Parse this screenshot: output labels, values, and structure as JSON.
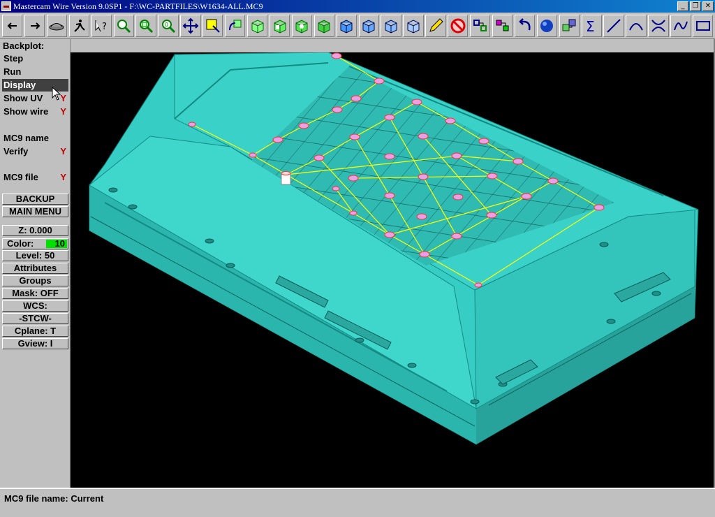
{
  "window": {
    "title": "Mastercam Wire Version 9.0SP1 - F:\\WC-PARTFILES\\W1634-ALL.MC9",
    "minimize": "_",
    "restore": "❐",
    "close": "✕"
  },
  "toolbar": {
    "icons": [
      "back-arrow-icon",
      "forward-arrow-icon",
      "dome-icon",
      "runner-icon",
      "arrow-question-icon",
      "zoom-icon",
      "zoom-window-icon",
      "zoom-fit-icon",
      "pan-icon",
      "select-box-icon",
      "rotate-icon",
      "view-top-icon",
      "view-front-icon",
      "view-side-icon",
      "view-iso-icon",
      "cube-icon",
      "cube2-icon",
      "cube3-icon",
      "cube4-icon",
      "pencil-icon",
      "no-entry-icon",
      "transform-icon",
      "transform2-icon",
      "undo-icon",
      "sphere-icon",
      "copy-icon",
      "sigma-icon",
      "line-icon",
      "arc-icon",
      "trim-icon",
      "spline-icon",
      "rectangle-icon"
    ]
  },
  "sidebar": {
    "title": "Backplot:",
    "items": [
      {
        "label": "Step",
        "flag": ""
      },
      {
        "label": "Run",
        "flag": ""
      },
      {
        "label": "Display",
        "flag": ""
      },
      {
        "label": "Show UV",
        "flag": "Y"
      },
      {
        "label": "Show wire",
        "flag": "Y"
      },
      {
        "label": "MC9 name",
        "flag": ""
      },
      {
        "label": "Verify",
        "flag": "Y"
      },
      {
        "label": "MC9 file",
        "flag": "Y"
      }
    ],
    "backup": "BACKUP",
    "main_menu": "MAIN MENU",
    "z": "Z:  0.000",
    "color_label": "Color:",
    "color_value": "10",
    "level": "Level: 50",
    "attributes": "Attributes",
    "groups": "Groups",
    "mask": "Mask:  OFF",
    "wcs": "WCS:",
    "stcw": "-STCW-",
    "cplane": "Cplane:  T",
    "gview": "Gview:   I"
  },
  "status": {
    "text": "MC9 file name: Current"
  },
  "colors": {
    "model": "#35cdc4",
    "wire": "#ffff00",
    "marker": "#ff3030",
    "color_swatch": "#00e000"
  }
}
